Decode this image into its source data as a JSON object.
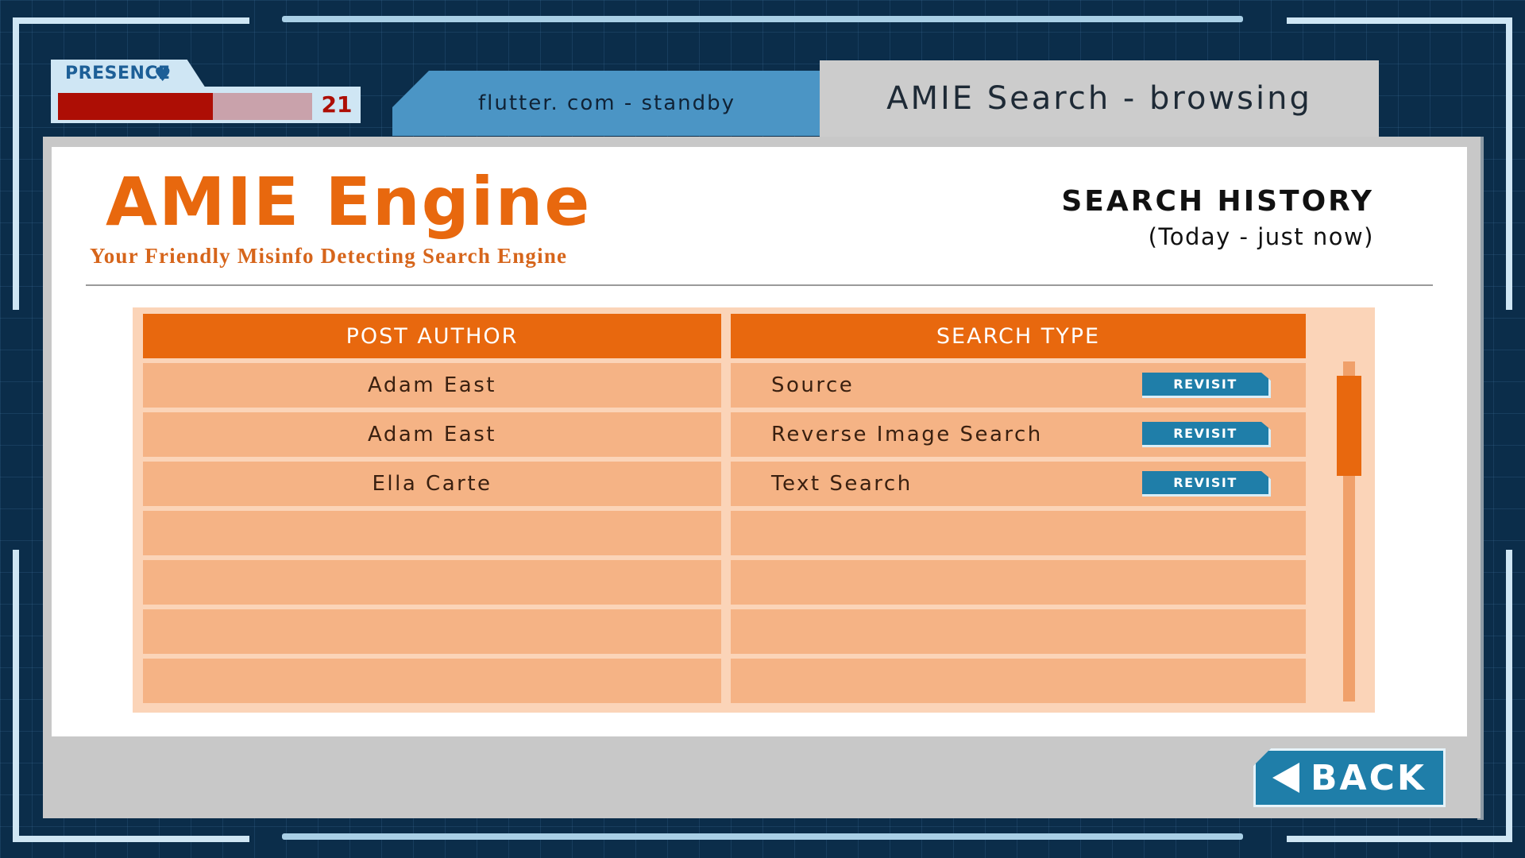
{
  "hud": {
    "presence_label": "PRESENCE",
    "presence_value": "21",
    "presence_fraction": 0.61
  },
  "tabs": [
    {
      "label": "flutter. com - standby",
      "active": false
    },
    {
      "label": "AMIE Search - browsing",
      "active": true
    }
  ],
  "header": {
    "logo_title": "AMIE Engine",
    "logo_tagline": "Your Friendly Misinfo Detecting Search Engine",
    "history_title": "SEARCH HISTORY",
    "history_subtitle": "(Today - just now)"
  },
  "table": {
    "columns": [
      "POST AUTHOR",
      "SEARCH TYPE"
    ],
    "rows": [
      {
        "author": "Adam East",
        "type": "Source",
        "action": "REVISIT"
      },
      {
        "author": "Adam East",
        "type": "Reverse Image Search",
        "action": "REVISIT"
      },
      {
        "author": "Ella Carte",
        "type": "Text Search",
        "action": "REVISIT"
      },
      {
        "author": "",
        "type": "",
        "action": ""
      },
      {
        "author": "",
        "type": "",
        "action": ""
      },
      {
        "author": "",
        "type": "",
        "action": ""
      },
      {
        "author": "",
        "type": "",
        "action": ""
      }
    ]
  },
  "back_label": "BACK",
  "colors": {
    "accent_orange": "#e8680e",
    "row_fill": "#f5b385",
    "button_blue": "#1f7ea9",
    "health_red": "#ad0e05",
    "background_navy": "#0b2d4a"
  }
}
